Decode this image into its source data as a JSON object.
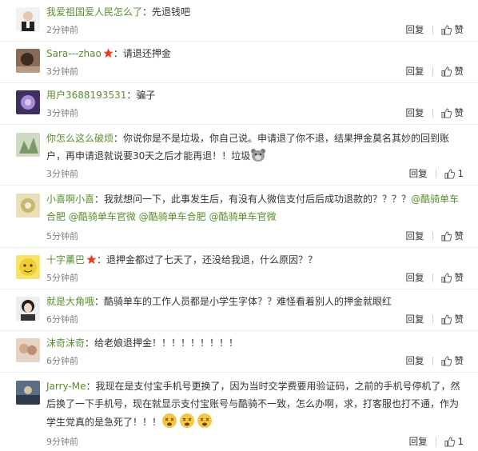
{
  "ui": {
    "reply_label": "回复",
    "like_label": "赞"
  },
  "comments": [
    {
      "user": "我爱祖国爱人民怎么了",
      "sep": "：",
      "text": "先退钱吧",
      "time": "2分钟前",
      "likes": ""
    },
    {
      "user": "Sara---zhao",
      "sep": "：",
      "text": "请退还押金",
      "time": "3分钟前",
      "likes": ""
    },
    {
      "user": "用户3688193531",
      "sep": "：",
      "text": "骗子",
      "time": "3分钟前",
      "likes": ""
    },
    {
      "user": "你怎么这么破烦",
      "sep": "：",
      "text_line1": "你说你是不是垃圾，你自己说。申请退了你不退，结果押金莫名其妙的回到账",
      "text_line2": "户，再申请退就说要30天之后才能再退！！垃圾",
      "time": "3分钟前",
      "likes": "1"
    },
    {
      "user": "小喜啊小喜",
      "sep": "：",
      "text_line1": "我就想问一下，此事发生后，有没有人微信支付后后成功退款的？？？？",
      "mention1": "@酷骑单车",
      "line2_a": "合肥 ",
      "mention2": "@酷骑单车官微",
      "mention3": "@酷骑单车合肥",
      "mention4": "@酷骑单车官微",
      "time": "5分钟前",
      "likes": ""
    },
    {
      "user": "十字薰巴",
      "sep": "：",
      "text": "退押金都过了七天了，还没给我退，什么原因？？",
      "time": "5分钟前",
      "likes": ""
    },
    {
      "user": "就是大角哦",
      "sep": "：",
      "text": "酷骑单车的工作人员都是小学生字体？？难怪看着别人的押金就眼红",
      "time": "6分钟前",
      "likes": ""
    },
    {
      "user": "沫奇沫奇",
      "sep": "：",
      "text": "给老娘退押金！！！！！！！！！",
      "time": "6分钟前",
      "likes": ""
    },
    {
      "user": "Jarry-Me",
      "sep": "：",
      "text_line1": "我现在是支付宝手机号更换了，因为当时交学费要用验证码，之前的手机号停机了，然",
      "text_line2": "后换了一下手机号，现在就显示支付宝账号与酷骑不一致，怎么办啊，求，打客服也打不通，作为",
      "text_line3": "学生党真的是急死了！！！",
      "time": "9分钟前",
      "likes": "1"
    }
  ],
  "colors": {
    "username": "#5a8f2e",
    "text": "#333333",
    "time": "#808080",
    "divider": "#ececec",
    "vip_star": "#e8401b"
  },
  "icons": [
    "thumb-up-icon",
    "vip-star-icon",
    "bear-emoji-icon",
    "dizzy-face-icon"
  ]
}
